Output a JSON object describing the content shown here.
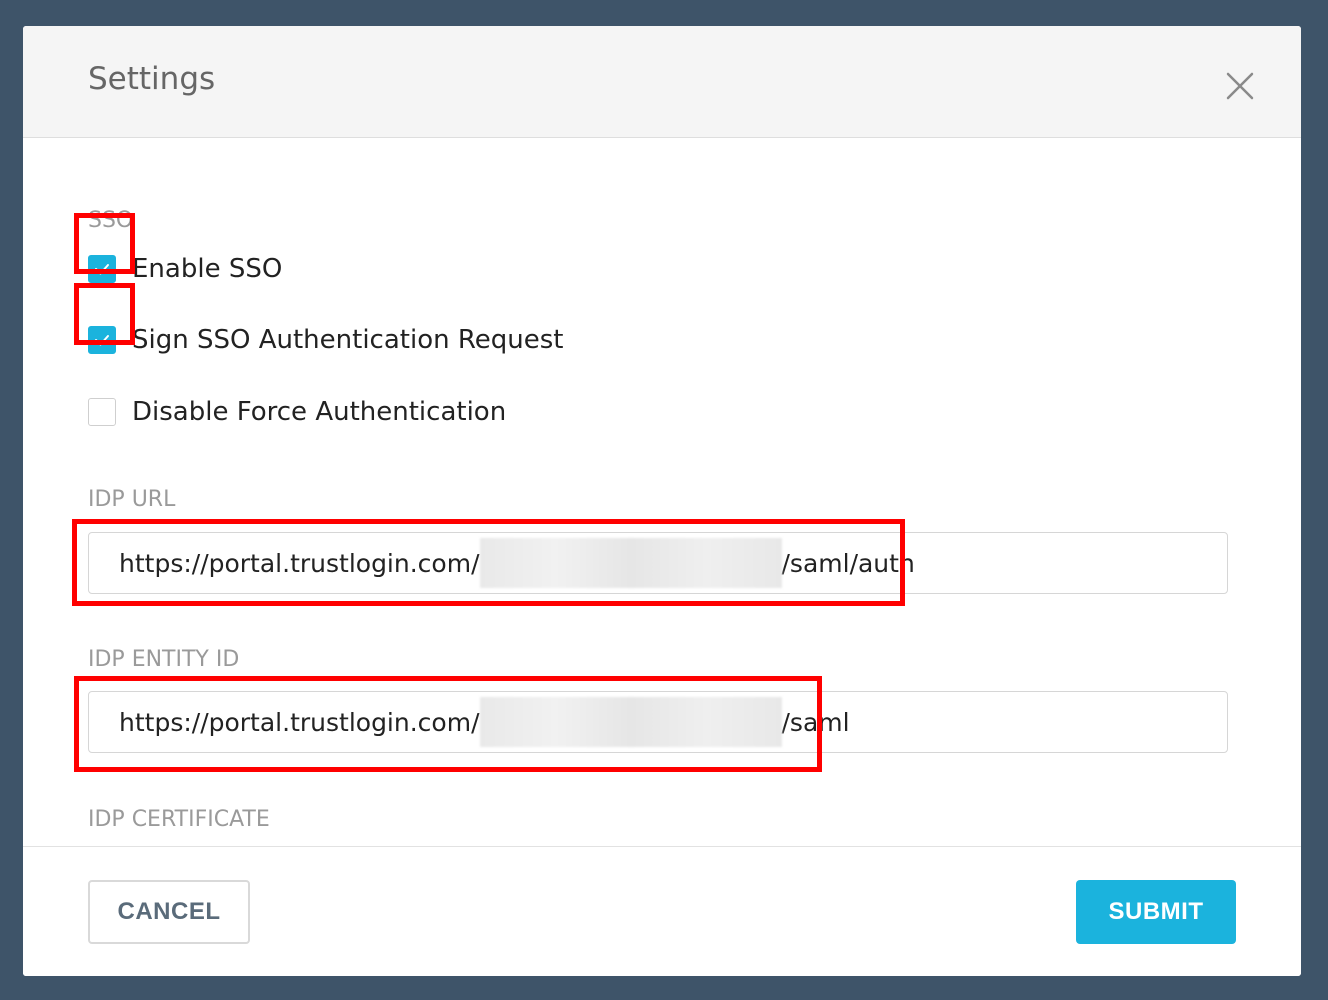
{
  "modal": {
    "title": "Settings"
  },
  "sso": {
    "section_label": "SSO",
    "options": [
      {
        "label": "Enable SSO",
        "checked": true
      },
      {
        "label": "Sign SSO Authentication Request",
        "checked": true
      },
      {
        "label": "Disable Force Authentication",
        "checked": false
      }
    ]
  },
  "idp_url": {
    "label": "IDP URL",
    "value_prefix": "https://portal.trustlogin.com/",
    "value_suffix": "/saml/auth"
  },
  "idp_entity_id": {
    "label": "IDP ENTITY ID",
    "value_prefix": "https://portal.trustlogin.com/",
    "value_suffix": "/saml"
  },
  "idp_certificate": {
    "label": "IDP CERTIFICATE"
  },
  "footer": {
    "cancel_label": "CANCEL",
    "submit_label": "SUBMIT"
  },
  "colors": {
    "accent": "#1bb3dd",
    "highlight": "#ff0000",
    "backdrop": "#3e5469"
  },
  "icons": {
    "close": "close-icon",
    "check": "check-icon"
  }
}
